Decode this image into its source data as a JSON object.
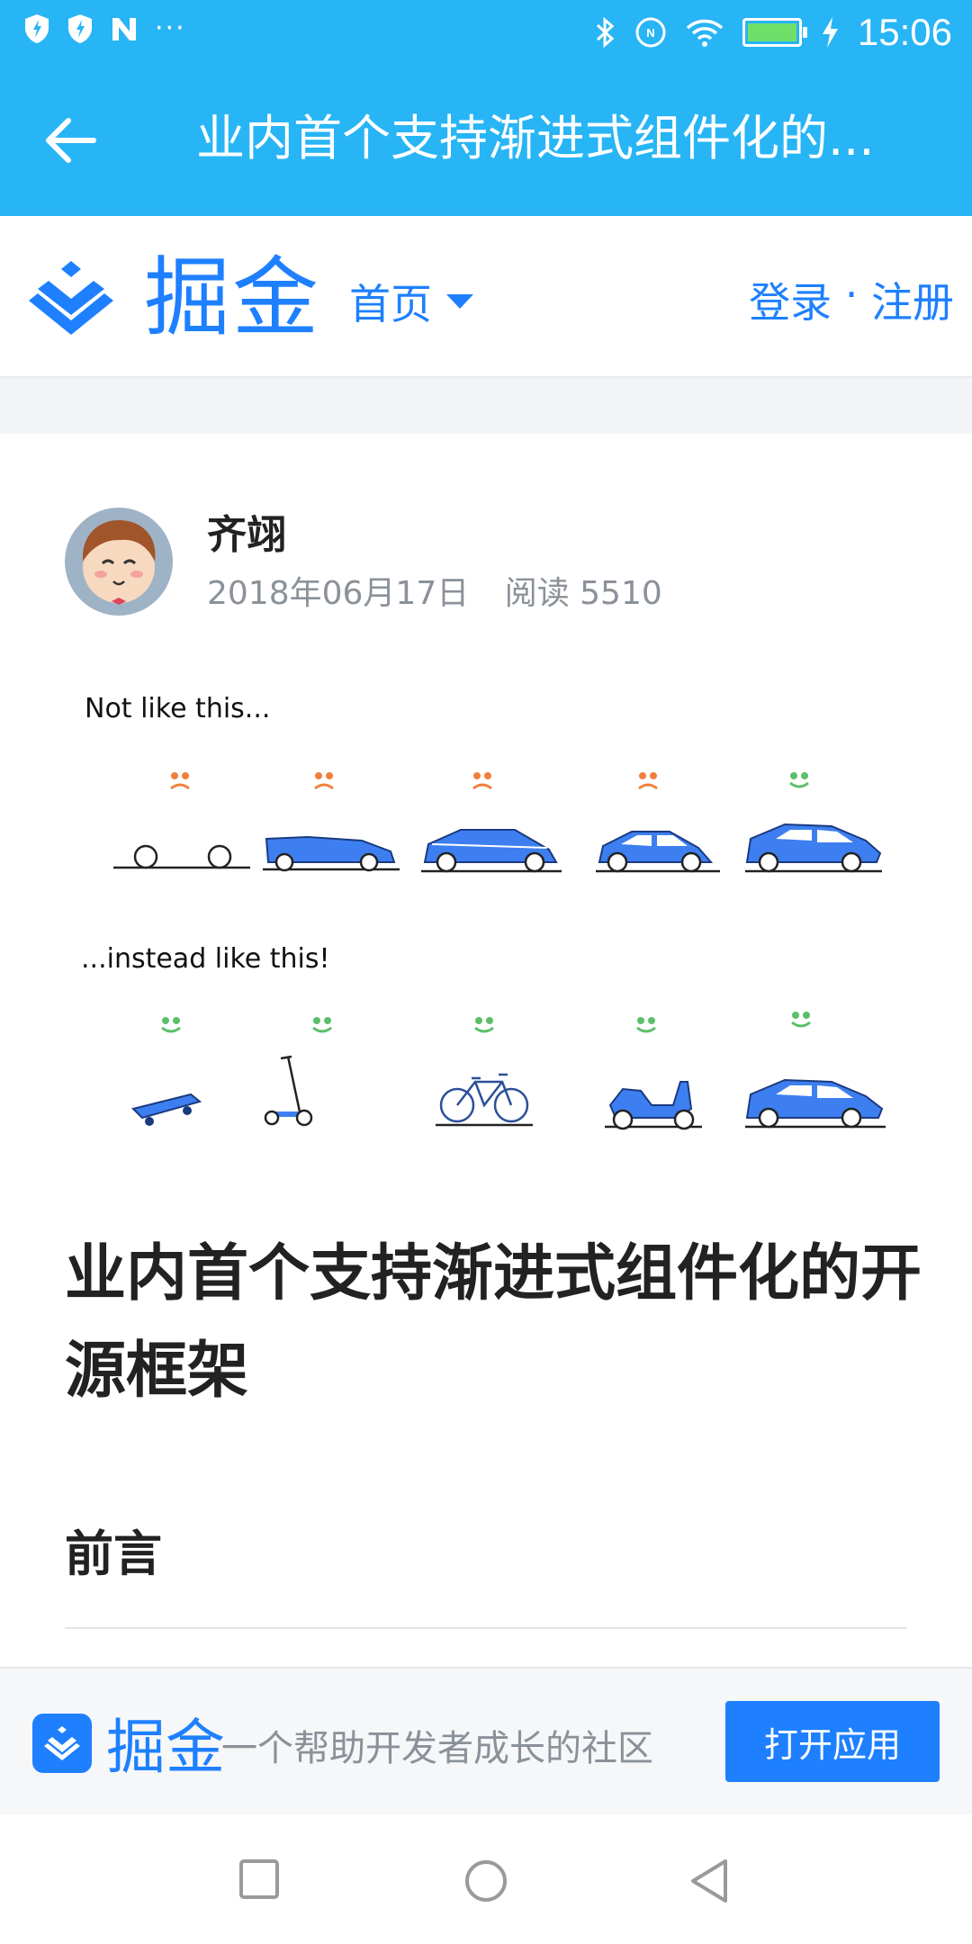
{
  "status_bar": {
    "time": "15:06",
    "left_icons": [
      "shield-icon",
      "shield-bolt-icon",
      "n-icon",
      "more-dots-icon"
    ],
    "right_icons": [
      "bluetooth-icon",
      "nfc-icon",
      "wifi-icon",
      "battery-icon",
      "charging-icon"
    ],
    "battery_level": 1.0,
    "more_text": "···"
  },
  "title_bar": {
    "title": "业内首个支持渐进式组件化的..."
  },
  "site_header": {
    "logo_text": "掘金",
    "nav_home": "首页",
    "login": "登录",
    "separator": " · ",
    "register": "注册"
  },
  "article": {
    "author": "齐翊",
    "date": "2018年06月17日",
    "reads": "阅读 5510",
    "hero": {
      "top_label": "Not like this...",
      "bottom_label": "...instead like this!"
    },
    "title": "业内首个支持渐进式组件化的开源框架",
    "section_heading": "前言"
  },
  "banner": {
    "logo_text": "掘金",
    "slogan": "一个帮助开发者成长的社区",
    "open_button": "打开应用"
  },
  "colors": {
    "status_bar": "#28b5f5",
    "brand": "#1e80ff",
    "car_blue": "#3d7ff0",
    "sad_face": "#f07f3c",
    "happy_face": "#5cbf6a"
  }
}
